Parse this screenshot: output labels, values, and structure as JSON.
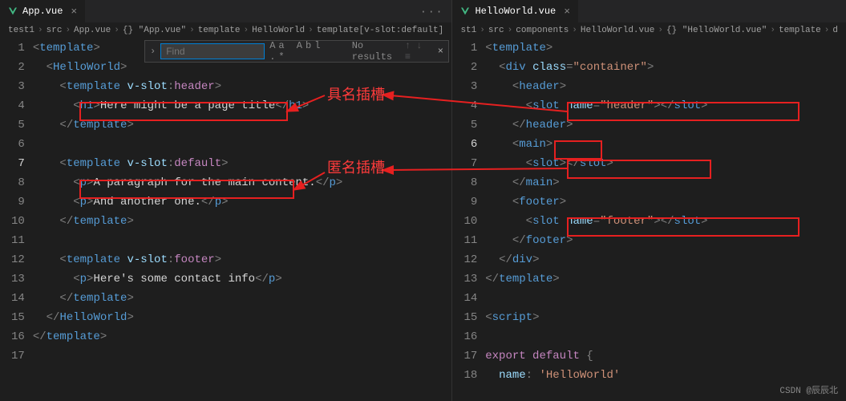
{
  "tabs": {
    "left": "App.vue",
    "right": "HelloWorld.vue"
  },
  "breadcrumb_left": [
    "test1",
    "src",
    "App.vue",
    "{} \"App.vue\"",
    "template",
    "HelloWorld",
    "template[v-slot:default]"
  ],
  "breadcrumb_right": [
    "st1",
    "src",
    "components",
    "HelloWorld.vue",
    "{} \"HelloWorld.vue\"",
    "template",
    "d"
  ],
  "find": {
    "label": "Find",
    "placeholder": "",
    "icons": "Aa Abl .*",
    "result": "No results",
    "nav": "↑  ↓  ≡",
    "close": "×"
  },
  "annotations": {
    "named": "具名插槽",
    "anon": "匿名插槽"
  },
  "left_code": {
    "lines": [
      {
        "n": 1,
        "html": "<span class='tag'>&lt;</span><span class='tagname'>template</span><span class='tag'>&gt;</span>"
      },
      {
        "n": 2,
        "html": "  <span class='tag'>&lt;</span><span class='tagname'>HelloWorld</span><span class='tag'>&gt;</span>"
      },
      {
        "n": 3,
        "html": "    <span class='tag'>&lt;</span><span class='tagname'>template</span> <span class='attr'>v-slot</span><span class='tag'>:</span><span class='slotname'>header</span><span class='tag'>&gt;</span>"
      },
      {
        "n": 4,
        "html": "      <span class='tag'>&lt;</span><span class='tagname'>h1</span><span class='tag'>&gt;</span><span class='text'>Here might be a page title</span><span class='tag'>&lt;/</span><span class='tagname'>h1</span><span class='tag'>&gt;</span>"
      },
      {
        "n": 5,
        "html": "    <span class='tag'>&lt;/</span><span class='tagname'>template</span><span class='tag'>&gt;</span>"
      },
      {
        "n": 6,
        "html": ""
      },
      {
        "n": 7,
        "active": true,
        "html": "    <span class='tag'>&lt;</span><span class='tagname'>template</span> <span class='attr'>v-slot</span><span class='tag'>:</span><span class='slotname'>default</span><span class='tag'>&gt;</span>"
      },
      {
        "n": 8,
        "html": "      <span class='tag'>&lt;</span><span class='tagname'>p</span><span class='tag'>&gt;</span><span class='text'>A paragraph for the main content.</span><span class='tag'>&lt;/</span><span class='tagname'>p</span><span class='tag'>&gt;</span>"
      },
      {
        "n": 9,
        "html": "      <span class='tag'>&lt;</span><span class='tagname'>p</span><span class='tag'>&gt;</span><span class='text'>And another one.</span><span class='tag'>&lt;/</span><span class='tagname'>p</span><span class='tag'>&gt;</span>"
      },
      {
        "n": 10,
        "html": "    <span class='tag'>&lt;/</span><span class='tagname'>template</span><span class='tag'>&gt;</span>"
      },
      {
        "n": 11,
        "html": ""
      },
      {
        "n": 12,
        "html": "    <span class='tag'>&lt;</span><span class='tagname'>template</span> <span class='attr'>v-slot</span><span class='tag'>:</span><span class='slotname'>footer</span><span class='tag'>&gt;</span>"
      },
      {
        "n": 13,
        "html": "      <span class='tag'>&lt;</span><span class='tagname'>p</span><span class='tag'>&gt;</span><span class='text'>Here's some contact info</span><span class='tag'>&lt;/</span><span class='tagname'>p</span><span class='tag'>&gt;</span>"
      },
      {
        "n": 14,
        "html": "    <span class='tag'>&lt;/</span><span class='tagname'>template</span><span class='tag'>&gt;</span>"
      },
      {
        "n": 15,
        "html": "  <span class='tag'>&lt;/</span><span class='tagname'>HelloWorld</span><span class='tag'>&gt;</span>"
      },
      {
        "n": 16,
        "html": "<span class='tag'>&lt;/</span><span class='tagname'>template</span><span class='tag'>&gt;</span>"
      },
      {
        "n": 17,
        "html": ""
      }
    ]
  },
  "right_code": {
    "lines": [
      {
        "n": 1,
        "html": "<span class='tag'>&lt;</span><span class='tagname'>template</span><span class='tag'>&gt;</span>"
      },
      {
        "n": 2,
        "html": "  <span class='tag'>&lt;</span><span class='tagname'>div</span> <span class='attr'>class</span><span class='tag'>=</span><span class='string'>\"container\"</span><span class='tag'>&gt;</span>"
      },
      {
        "n": 3,
        "html": "    <span class='tag'>&lt;</span><span class='tagname'>header</span><span class='tag'>&gt;</span>"
      },
      {
        "n": 4,
        "html": "      <span class='tag'>&lt;</span><span class='tagname'>slot</span> <span class='attr'>name</span><span class='tag'>=</span><span class='string'>\"header\"</span><span class='tag'>&gt;&lt;/</span><span class='tagname'>slot</span><span class='tag'>&gt;</span>"
      },
      {
        "n": 5,
        "html": "    <span class='tag'>&lt;/</span><span class='tagname'>header</span><span class='tag'>&gt;</span>"
      },
      {
        "n": 6,
        "active": true,
        "html": "    <span class='tag'>&lt;</span><span class='tagname'>main</span><span class='tag'>&gt;</span>"
      },
      {
        "n": 7,
        "html": "      <span class='tag'>&lt;</span><span class='tagname'>slot</span><span class='tag'>&gt;&lt;/</span><span class='tagname'>slot</span><span class='tag'>&gt;</span>"
      },
      {
        "n": 8,
        "html": "    <span class='tag'>&lt;/</span><span class='tagname'>main</span><span class='tag'>&gt;</span>"
      },
      {
        "n": 9,
        "html": "    <span class='tag'>&lt;</span><span class='tagname'>footer</span><span class='tag'>&gt;</span>"
      },
      {
        "n": 10,
        "html": "      <span class='tag'>&lt;</span><span class='tagname'>slot</span> <span class='attr'>name</span><span class='tag'>=</span><span class='string'>\"footer\"</span><span class='tag'>&gt;&lt;/</span><span class='tagname'>slot</span><span class='tag'>&gt;</span>"
      },
      {
        "n": 11,
        "html": "    <span class='tag'>&lt;/</span><span class='tagname'>footer</span><span class='tag'>&gt;</span>"
      },
      {
        "n": 12,
        "html": "  <span class='tag'>&lt;/</span><span class='tagname'>div</span><span class='tag'>&gt;</span>"
      },
      {
        "n": 13,
        "html": "<span class='tag'>&lt;/</span><span class='tagname'>template</span><span class='tag'>&gt;</span>"
      },
      {
        "n": 14,
        "html": ""
      },
      {
        "n": 15,
        "html": "<span class='tag'>&lt;</span><span class='tagname'>script</span><span class='tag'>&gt;</span>"
      },
      {
        "n": 16,
        "html": ""
      },
      {
        "n": 17,
        "html": "<span class='slotname'>export default</span> <span class='tag'>{</span>"
      },
      {
        "n": 18,
        "html": "  <span class='attr'>name</span><span class='tag'>:</span> <span class='string'>'HelloWorld'</span>"
      }
    ]
  },
  "watermark": "CSDN @辰辰北"
}
